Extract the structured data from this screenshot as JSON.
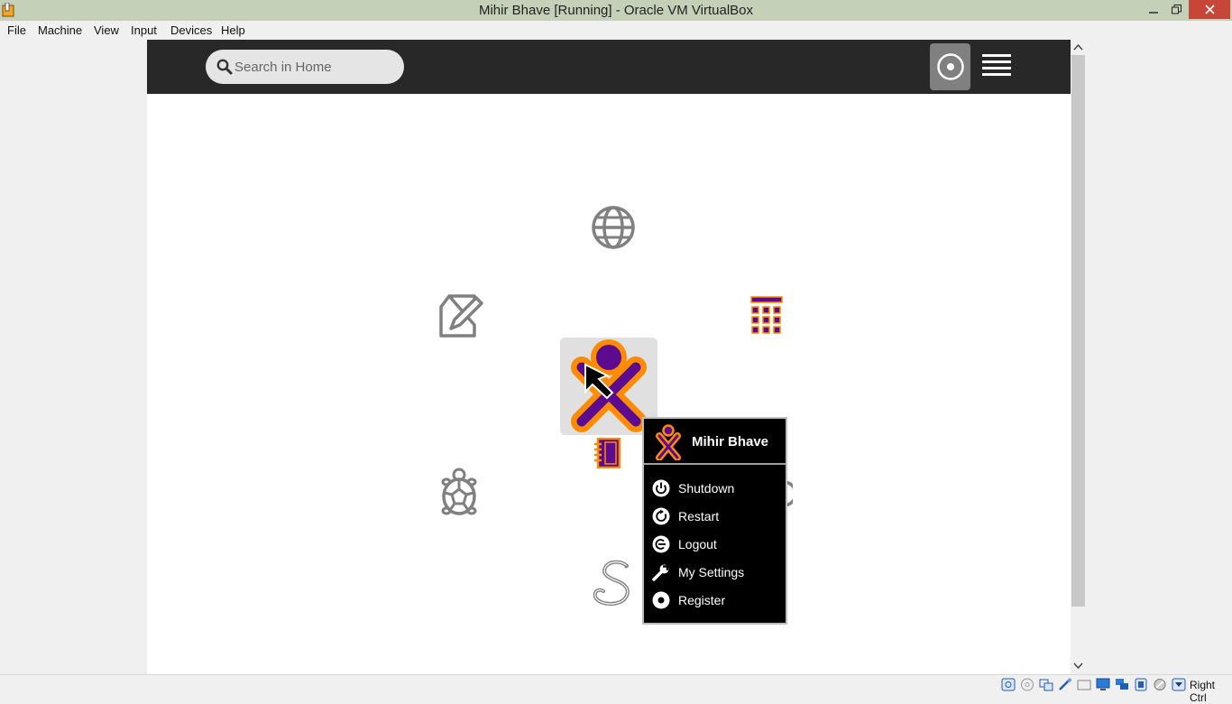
{
  "window": {
    "title": "Mihir Bhave [Running] - Oracle VM VirtualBox"
  },
  "menu": [
    "File",
    "Machine",
    "View",
    "Input",
    "Devices",
    "Help"
  ],
  "search": {
    "placeholder": "Search in Home"
  },
  "user": {
    "name": "Mihir Bhave",
    "stroke_color": "#ff8c00",
    "fill_color": "#5c0b8f"
  },
  "palette_items": [
    "Shutdown",
    "Restart",
    "Logout",
    "My Settings",
    "Register"
  ],
  "activity_icons": [
    "globe-icon",
    "write-icon",
    "calculator-icon",
    "journal-icon",
    "turtle-icon",
    "python-snake-icon"
  ],
  "statusbar": {
    "host_key": "Right Ctrl"
  }
}
